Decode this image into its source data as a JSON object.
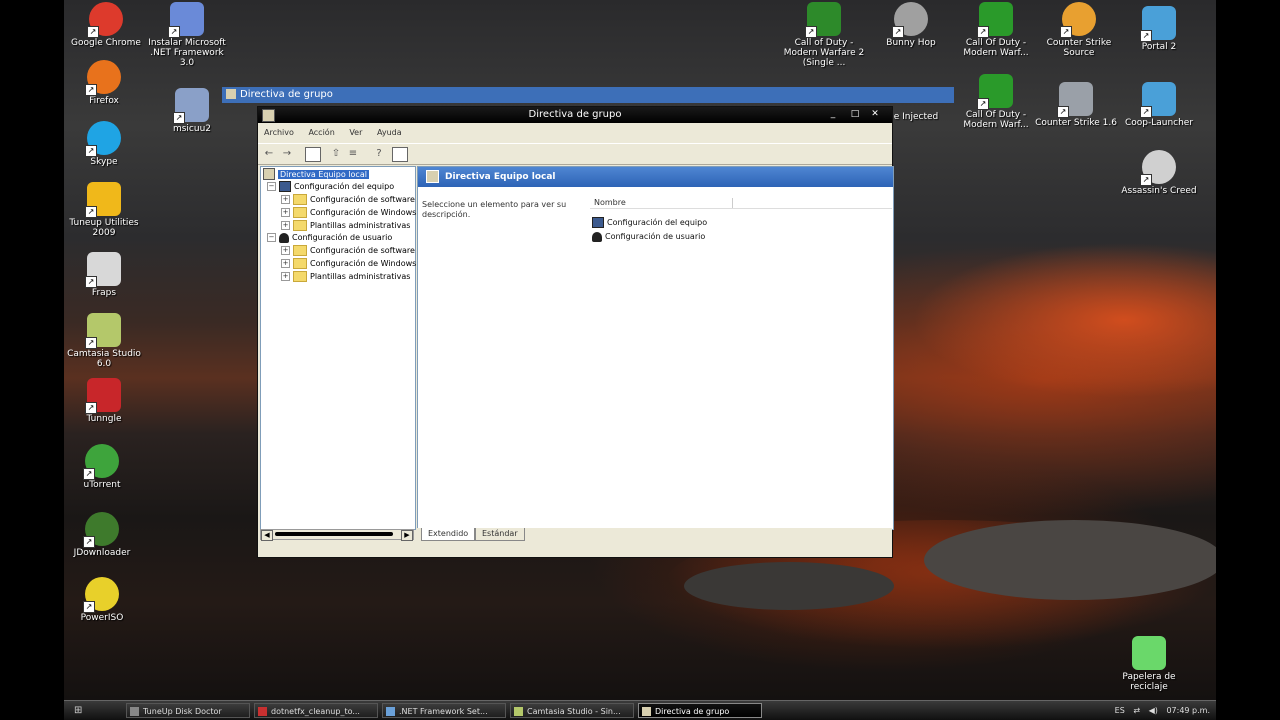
{
  "desktop": {
    "left_icons": [
      {
        "label": "Google Chrome",
        "color": "#dd3a2c"
      },
      {
        "label": "Firefox",
        "color": "#e8721c"
      },
      {
        "label": "Skype",
        "color": "#1fa4e4"
      },
      {
        "label": "Tuneup Utilities 2009",
        "color": "#f0b81a"
      },
      {
        "label": "Fraps",
        "color": "#d8d8d8"
      },
      {
        "label": "Camtasia Studio 6.0",
        "color": "#b4c86a"
      },
      {
        "label": "Tunngle",
        "color": "#c8262a"
      },
      {
        "label": "uTorrent",
        "color": "#3ea43c"
      },
      {
        "label": "JDownloader",
        "color": "#3e7a2c"
      },
      {
        "label": "PowerISO",
        "color": "#e8d02a"
      }
    ],
    "second_col_icons": [
      {
        "label": "Instalar Microsoft .NET Framework 3.0",
        "color": "#6a8ad8"
      },
      {
        "label": "msicuu2",
        "color": "#8aa0c8"
      }
    ],
    "right_icons": [
      {
        "label": "Call of Duty - Modern Warfare 2 (Single ...",
        "color": "#2d8a2a"
      },
      {
        "label": "Bunny Hop",
        "color": "#a0a0a0"
      },
      {
        "label": "Call Of Duty - Modern Warf...",
        "color": "#2a9a2a"
      },
      {
        "label": "Counter Strike Source",
        "color": "#e8a030"
      },
      {
        "label": "Portal 2",
        "color": "#4aa0d8"
      },
      {
        "label": "e Injected",
        "color": "#d89030"
      },
      {
        "label": "Call Of Duty - Modern Warf...",
        "color": "#2a9a2a"
      },
      {
        "label": "Counter Strike 1.6",
        "color": "#9aa0a8"
      },
      {
        "label": "Coop-Launcher",
        "color": "#4aa0d8"
      },
      {
        "label": "Assassin's Creed",
        "color": "#d0d0d0"
      },
      {
        "label": "Papelera de reciclaje",
        "color": "#6ad86a"
      }
    ]
  },
  "background_window": {
    "title": "Directiva de grupo"
  },
  "window": {
    "title": "Directiva de grupo",
    "menu": [
      "Archivo",
      "Acción",
      "Ver",
      "Ayuda"
    ],
    "toolbar_icons": [
      "back-arrow-icon",
      "forward-arrow-icon",
      "show-tree-icon",
      "up-folder-icon",
      "export-list-icon",
      "help-icon",
      "console-icon"
    ],
    "tree": {
      "root": "Directiva Equipo local",
      "computer_config": "Configuración del equipo",
      "computer_children": [
        "Configuración de software",
        "Configuración de Windows",
        "Plantillas administrativas"
      ],
      "user_config": "Configuración de usuario",
      "user_children": [
        "Configuración de software",
        "Configuración de Windows",
        "Plantillas administrativas"
      ]
    },
    "content": {
      "header": "Directiva Equipo local",
      "description": "Seleccione un elemento para ver su descripción.",
      "column": "Nombre",
      "items": [
        "Configuración del equipo",
        "Configuración de usuario"
      ]
    },
    "tabs": [
      "Extendido",
      "Estándar"
    ]
  },
  "taskbar": {
    "buttons": [
      {
        "label": "TuneUp Disk Doctor",
        "active": false
      },
      {
        "label": "dotnetfx_cleanup_to...",
        "active": false
      },
      {
        "label": ".NET Framework Set...",
        "active": false
      },
      {
        "label": "Camtasia Studio - Sin...",
        "active": false
      },
      {
        "label": "Directiva de grupo",
        "active": true
      }
    ],
    "tray": {
      "language": "ES",
      "clock": "07:49 p.m."
    }
  }
}
